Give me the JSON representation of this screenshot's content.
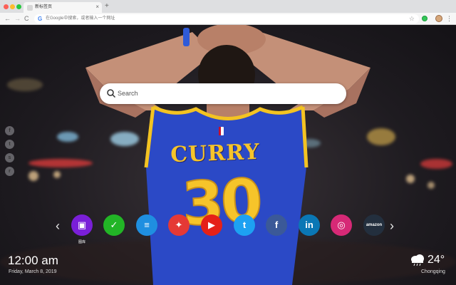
{
  "browser": {
    "tab_title": "新标签页",
    "tab_close": "×",
    "new_tab": "+",
    "omnibox_placeholder": "在Google中搜索，或者输入一个网址",
    "google_glyph": "G",
    "bookmark_glyph": "☆",
    "menu_glyph": "⋮",
    "nav": {
      "back": "←",
      "forward": "→",
      "reload": "C"
    }
  },
  "search": {
    "placeholder": "Search"
  },
  "jersey": {
    "name": "CURRY",
    "number": "30"
  },
  "social": [
    {
      "icon": "facebook-icon",
      "glyph": "f"
    },
    {
      "icon": "twitter-icon",
      "glyph": "t"
    },
    {
      "icon": "snapchat-icon",
      "glyph": "s"
    },
    {
      "icon": "reddit-icon",
      "glyph": "r"
    }
  ],
  "dock": {
    "left_arrow": "‹",
    "right_arrow": "›",
    "apps": [
      {
        "name": "图库",
        "icon": "gallery-icon",
        "glyph": "▣",
        "color": "#7a1fd8"
      },
      {
        "name": "",
        "icon": "tasks-icon",
        "glyph": "✓",
        "color": "#22b526"
      },
      {
        "name": "",
        "icon": "news-icon",
        "glyph": "≡",
        "color": "#1f8fe0"
      },
      {
        "name": "",
        "icon": "game-icon",
        "glyph": "✦",
        "color": "#e53935"
      },
      {
        "name": "",
        "icon": "youtube-icon",
        "glyph": "▶",
        "color": "#e52117"
      },
      {
        "name": "",
        "icon": "twitter-icon",
        "glyph": "t",
        "color": "#1da1f2"
      },
      {
        "name": "",
        "icon": "facebook-icon",
        "glyph": "f",
        "color": "#3b5998"
      },
      {
        "name": "",
        "icon": "linkedin-icon",
        "glyph": "in",
        "color": "#0a77b5"
      },
      {
        "name": "",
        "icon": "instagram-icon",
        "glyph": "◎",
        "color": "#d62976"
      },
      {
        "name": "",
        "icon": "amazon-icon",
        "glyph": "amazon",
        "color": "#232f3e"
      }
    ]
  },
  "clock": {
    "time": "12:00 am",
    "date": "Friday, March 8, 2019"
  },
  "weather": {
    "temp": "24°",
    "city": "Chongqing",
    "icon": "cloud-rain-icon"
  }
}
